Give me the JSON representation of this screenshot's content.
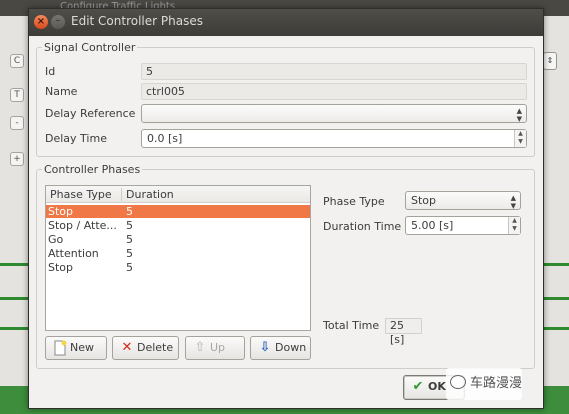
{
  "background_window": {
    "title": "Configure Traffic Lights",
    "left_strip_glyphs": [
      "C",
      "T",
      "-",
      "+"
    ]
  },
  "dialog": {
    "title": "Edit Controller Phases",
    "signal_controller": {
      "group_title": "Signal Controller",
      "id_label": "Id",
      "id_value": "5",
      "name_label": "Name",
      "name_value": "ctrl005",
      "delay_reference_label": "Delay Reference",
      "delay_reference_value": "",
      "delay_time_label": "Delay Time",
      "delay_time_value": "0.0 [s]"
    },
    "controller_phases": {
      "group_title": "Controller Phases",
      "columns": [
        "Phase Type",
        "Duration"
      ],
      "rows": [
        {
          "phase_type": "Stop",
          "duration": "5",
          "selected": true
        },
        {
          "phase_type": "Stop / Atte...",
          "duration": "5",
          "selected": false
        },
        {
          "phase_type": "Go",
          "duration": "5",
          "selected": false
        },
        {
          "phase_type": "Attention",
          "duration": "5",
          "selected": false
        },
        {
          "phase_type": "Stop",
          "duration": "5",
          "selected": false
        }
      ],
      "phase_type_label": "Phase Type",
      "phase_type_value": "Stop",
      "duration_time_label": "Duration Time",
      "duration_time_value": "5.00 [s]",
      "total_time_label": "Total Time",
      "total_time_value": "25 [s]",
      "buttons": {
        "new": "New",
        "delete": "Delete",
        "up": "Up",
        "down": "Down"
      }
    },
    "ok_label": "OK"
  },
  "watermark_text": "车路漫漫",
  "colors": {
    "selection": "#f07746",
    "titlebar": "#3d3c38",
    "close_button": "#e15a2b",
    "green_background": "#3d8d3d"
  },
  "icons": {
    "new": "new-document-icon",
    "delete": "red-x-icon",
    "up": "arrow-up-icon",
    "down": "arrow-down-icon",
    "ok": "green-check-icon"
  }
}
